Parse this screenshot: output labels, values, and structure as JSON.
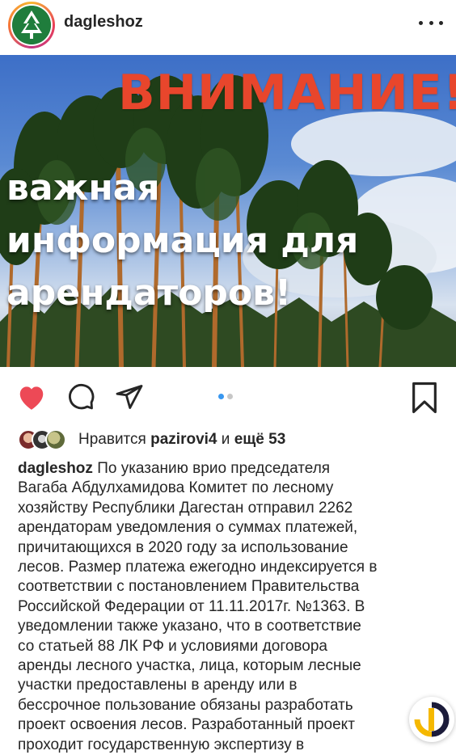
{
  "post": {
    "username": "dagleshoz",
    "more_icon": "more-horizontal-icon"
  },
  "photo": {
    "title": "ВНИМАНИЕ!",
    "lines": [
      "важная",
      "информация для",
      "арендаторов!"
    ],
    "title_color": "#e8462c"
  },
  "actions": {
    "like_icon": "heart-filled-icon",
    "like_color": "#ed4956",
    "comment_icon": "comment-icon",
    "share_icon": "paper-plane-icon",
    "save_icon": "bookmark-icon",
    "carousel": {
      "count": 2,
      "active_index": 0
    }
  },
  "likes": {
    "prefix": "Нравится",
    "user": "pazirovi4",
    "connector": "и",
    "more": "ещё 53"
  },
  "caption": {
    "username": "dagleshoz",
    "lines": [
      "По указанию врио председателя",
      "Вагаба Абдулхамидова Комитет по лесному",
      "хозяйству Республики Дагестан отправил 2262",
      "арендаторам уведомления о суммах платежей,",
      "причитающихся в 2020 году за использование",
      "лесов. Размер платежа ежегодно индексируется в",
      "соответствии с постановлением Правительства",
      "Российской Федерации от 11.11.2017г. №1363. В",
      "уведомлении также указано, что в соответствие",
      "со статьей 88 ЛК РФ и условиями договора",
      "аренды лесного участка, лица, которым лесные",
      "участки предоставлены в аренду или в",
      "бессрочное пользование обязаны разработать",
      "проект освоения лесов. Разработанный проект",
      "проходит государственную экспертизу в"
    ]
  }
}
